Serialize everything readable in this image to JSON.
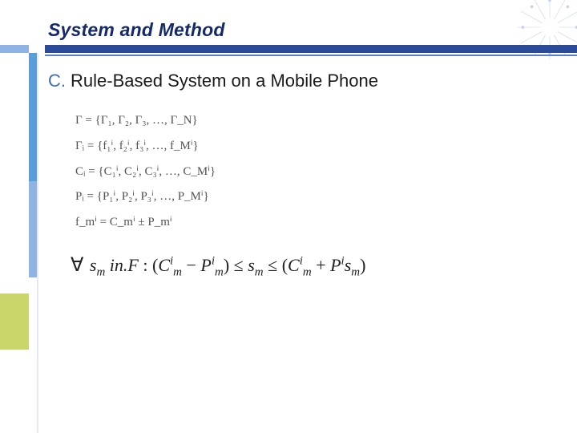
{
  "title": "System and Method",
  "section": {
    "lead": "C.",
    "heading": "Rule-Based System on a Mobile Phone"
  },
  "eq": {
    "gamma_set": "Γ = {Γ₁, Γ₂, Γ₃, …, Γ_N}",
    "gamma_i": "Γᵢ = {f₁ⁱ, f₂ⁱ, f₃ⁱ, …, f_Mⁱ}",
    "c_i": "Cᵢ = {C₁ⁱ, C₂ⁱ, C₃ⁱ, …, C_Mⁱ}",
    "p_i": "Pᵢ = {P₁ⁱ, P₂ⁱ, P₃ⁱ, …, P_Mⁱ}",
    "f_im": "f_mⁱ = C_mⁱ ± P_mⁱ"
  },
  "ineq": {
    "forall": "∀",
    "var_s": "s",
    "sub_m": "m",
    "in": "in.",
    "F": "F",
    "colon": " : ",
    "open": "(",
    "close": ")",
    "C": "C",
    "P": "P",
    "minus": " − ",
    "plus": " + ",
    "le1": " ≤ ",
    "le2": " ≤ ",
    "sup_i": "i"
  }
}
